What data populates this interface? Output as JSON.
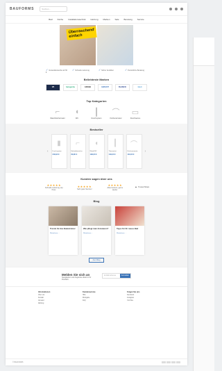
{
  "header": {
    "logo": "BAUFORMS",
    "search_placeholder": "Suchen...",
    "icons": [
      "user-icon",
      "heart-icon",
      "cart-icon"
    ]
  },
  "nav": [
    "Bad",
    "Küche",
    "Installationstechnik",
    "Heizung",
    "Marken",
    "Sale",
    "Beratung",
    "Service"
  ],
  "hero": {
    "promo": "Überraschend einfach"
  },
  "features": [
    "Versandkostenfrei ab 50 €",
    "Schnelle Lieferung",
    "Sicher bezahlen",
    "Persönliche Beratung"
  ],
  "brands_title": "Beliebteste Marken",
  "brands": [
    "VB",
    "hansgrohe",
    "GROHE",
    "GEBERIT",
    "BLANCO",
    "kludi"
  ],
  "categories_title": "Top Kategorien",
  "categories": [
    "Waschtischarmatur",
    "WC",
    "Duschsystem",
    "Küchenarmatur",
    "Duschwanne"
  ],
  "bestsellers_title": "Bestseller",
  "bestsellers": [
    {
      "name": "Duschsystem",
      "price": "249,90 €"
    },
    {
      "name": "Einhebelmischer",
      "price": "89,90 €"
    },
    {
      "name": "Wand-WC",
      "price": "199,00 €"
    },
    {
      "name": "Thermostat",
      "price": "149,00 €"
    },
    {
      "name": "Küchenarmatur",
      "price": "119,00 €"
    }
  ],
  "reviews_title": "Kunden sagen über uns",
  "reviews": [
    {
      "stars": "★★★★★",
      "text": "Schnelle Lieferung, top Preis."
    },
    {
      "stars": "★★★★★",
      "text": "Sehr guter Service!"
    },
    {
      "stars": "★★★★★",
      "text": "Alles bestens, gerne wieder."
    }
  ],
  "trust_label": "Trusted Shops",
  "blog_title": "Blog",
  "blog_posts": [
    {
      "title": "Trends für das Badezimmer",
      "more": "Weiterlesen →"
    },
    {
      "title": "Wie pflegt man Armaturen?",
      "more": "Weiterlesen →"
    },
    {
      "title": "Tipps für Ihr neues Bad",
      "more": "Weiterlesen →"
    }
  ],
  "blog_all": "Zum Blog",
  "newsletter": {
    "title": "Melden Sie sich an",
    "subtitle": "Neuigkeiten und Angebote direkt in Ihr Postfach.",
    "placeholder": "E-Mail-Adresse",
    "button": "Anmelden"
  },
  "footer": [
    {
      "title": "Informationen",
      "items": [
        "Über uns",
        "Kontakt",
        "Versand",
        "Zahlung"
      ]
    },
    {
      "title": "Kundenservice",
      "items": [
        "Hilfe",
        "Rückgabe",
        "FAQ"
      ]
    },
    {
      "title": "Folgen Sie uns",
      "items": [
        "Facebook",
        "Instagram",
        "YouTube"
      ]
    }
  ],
  "copyright": "© BAUFORMS"
}
